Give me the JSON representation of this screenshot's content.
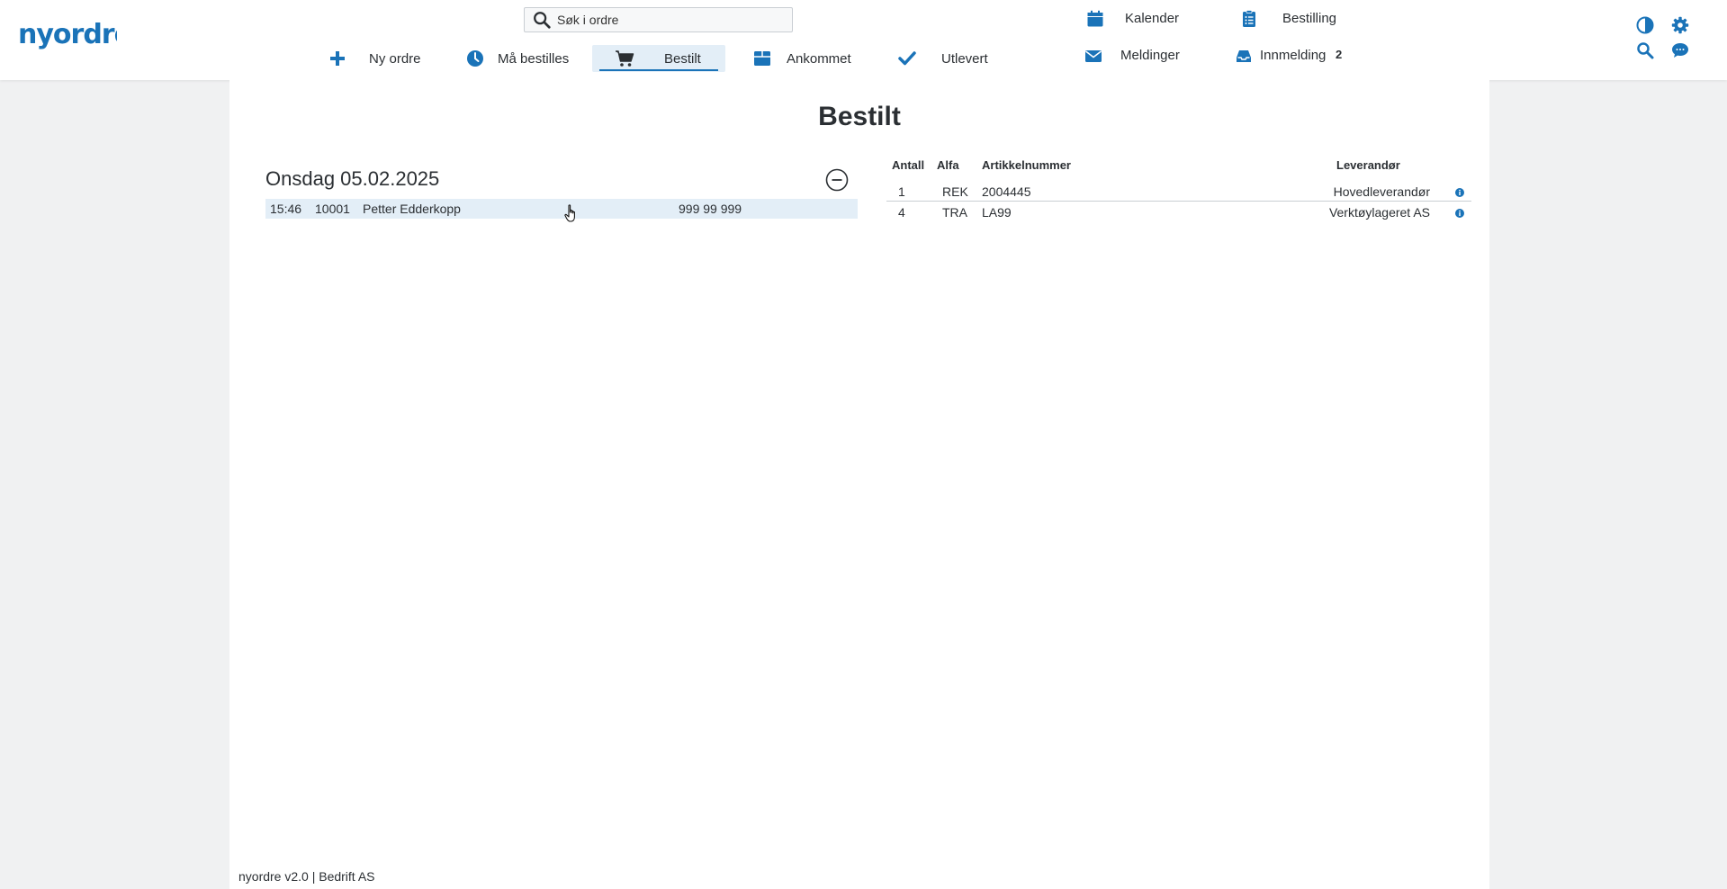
{
  "app": {
    "logo_text": "nyordre",
    "search_placeholder": "Søk i ordre"
  },
  "nav": {
    "items": [
      {
        "label": "Ny ordre",
        "icon": "plus-icon"
      },
      {
        "label": "Må bestilles",
        "icon": "clock-icon"
      },
      {
        "label": "Bestilt",
        "icon": "cart-icon",
        "active": true
      },
      {
        "label": "Ankommet",
        "icon": "box-icon"
      },
      {
        "label": "Utlevert",
        "icon": "check-icon"
      }
    ]
  },
  "utility": {
    "kalender": "Kalender",
    "bestilling": "Bestilling",
    "meldinger": "Meldinger",
    "innmelding": "Innmelding",
    "innmelding_count": "2"
  },
  "page": {
    "title": "Bestilt",
    "day": "Onsdag 05.02.2025",
    "order": {
      "time": "15:46",
      "number": "10001",
      "customer": "Petter Edderkopp",
      "phone": "999 99 999"
    }
  },
  "items_table": {
    "headers": {
      "antall": "Antall",
      "alfa": "Alfa",
      "artikkelnummer": "Artikkelnummer",
      "leverandor": "Leverandør"
    },
    "rows": [
      {
        "antall": "1",
        "alfa": "REK",
        "artikkelnummer": "2004445",
        "leverandor": "Hovedleverandør"
      },
      {
        "antall": "4",
        "alfa": "TRA",
        "artikkelnummer": "LA99",
        "leverandor": "Verktøylageret AS"
      }
    ]
  },
  "footer": {
    "text": "nyordre v2.0 | Bedrift AS"
  },
  "colors": {
    "accent": "#1a73b8",
    "active_bg": "#e3eef7",
    "page_bg": "#f0f1f2"
  }
}
